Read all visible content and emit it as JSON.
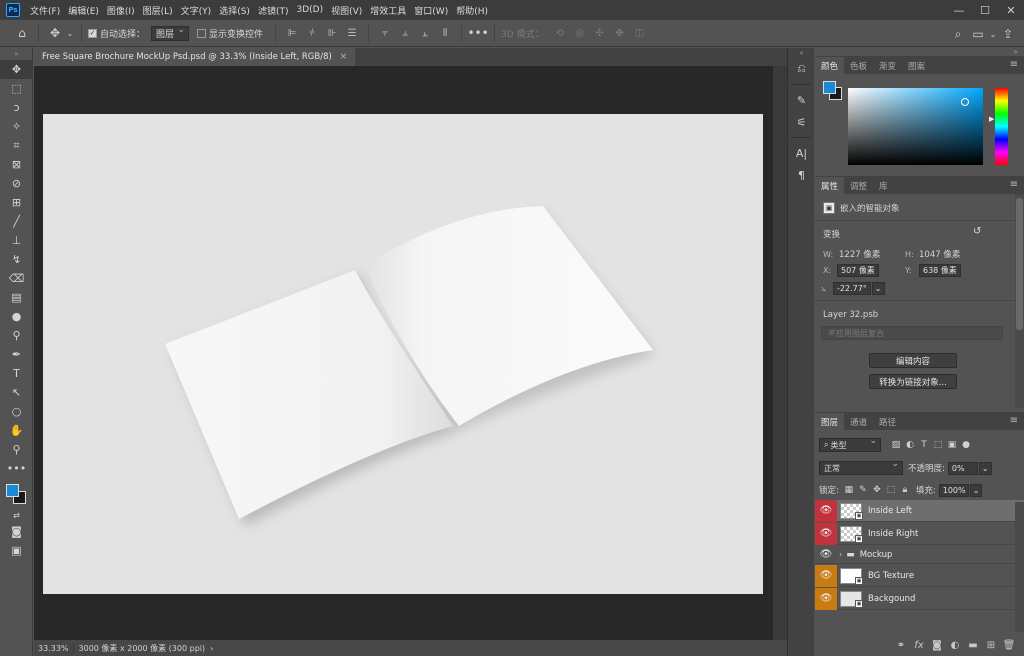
{
  "app": {
    "logo_text": "Ps"
  },
  "menu": [
    "文件(F)",
    "编辑(E)",
    "图像(I)",
    "图层(L)",
    "文字(Y)",
    "选择(S)",
    "滤镜(T)",
    "3D(D)",
    "视图(V)",
    "增效工具",
    "窗口(W)",
    "帮助(H)"
  ],
  "options": {
    "auto_select_label": "自动选择：",
    "auto_select_target": "图层",
    "show_transform_label": "显示变换控件",
    "three_d_mode_label": "3D 模式："
  },
  "document": {
    "tab_title": "Free Square Brochure MockUp Psd.psd @ 33.3% (Inside Left, RGB/8)",
    "close_glyph": "×"
  },
  "status": {
    "zoom": "33.33%",
    "info": "3000 像素 x 2000 像素 (300 ppi)",
    "arrow": "›"
  },
  "color_panel": {
    "tabs": [
      "颜色",
      "色板",
      "渐变",
      "图案"
    ],
    "fg_color": "#1a8ad6",
    "bg_color": "#1a1a1a"
  },
  "properties_panel": {
    "tabs": [
      "属性",
      "调整",
      "库"
    ],
    "object_type": "嵌入的智能对象",
    "transform_label": "变换",
    "w_label": "W:",
    "w_value": "1227 像素",
    "h_label": "H:",
    "h_value": "1047 像素",
    "x_label": "X:",
    "x_value": "507 像素",
    "y_label": "Y:",
    "y_value": "638 像素",
    "angle_value": "-22.77°",
    "source_file": "Layer 32.psb",
    "comp_placeholder": "不应用图层复合",
    "edit_button": "编辑内容",
    "convert_button": "转换为链接对象..."
  },
  "layers_panel": {
    "tabs": [
      "图层",
      "通道",
      "路径"
    ],
    "filter_kind": "类型",
    "blend_mode": "正常",
    "opacity_label": "不透明度:",
    "opacity_value": "0%",
    "lock_label": "锁定:",
    "fill_label": "填充:",
    "fill_value": "100%",
    "layers": [
      {
        "name": "Inside Left",
        "eye_color": "red",
        "selected": true,
        "kind": "smart",
        "thumb": "checker"
      },
      {
        "name": "Inside Right",
        "eye_color": "red",
        "selected": false,
        "kind": "smart",
        "thumb": "checker"
      },
      {
        "name": "Mockup",
        "eye_color": "none",
        "selected": false,
        "kind": "group",
        "thumb": ""
      },
      {
        "name": "BG Texture",
        "eye_color": "orange",
        "selected": false,
        "kind": "smart",
        "thumb": "white"
      },
      {
        "name": "Backgound",
        "eye_color": "orange",
        "selected": false,
        "kind": "smart",
        "thumb": "grey"
      }
    ]
  }
}
